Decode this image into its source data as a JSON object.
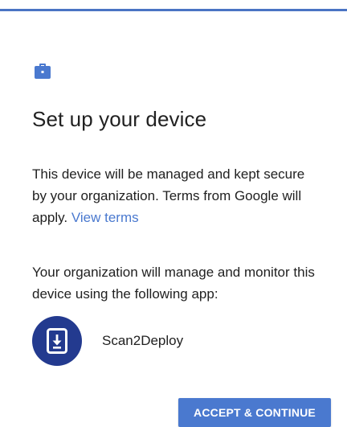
{
  "dialog": {
    "title": "Set up your device",
    "description": "This device will be managed and kept secure by your organization. Terms from Google will apply.",
    "terms_link": "View terms",
    "manage_text": "Your organization will manage and monitor this device using the following app:"
  },
  "app": {
    "name": "Scan2Deploy",
    "icon": "download-phone-icon"
  },
  "actions": {
    "accept_label": "ACCEPT & CONTINUE"
  },
  "colors": {
    "accent": "#4a79cf",
    "top_bar": "#4a74c4",
    "app_avatar": "#233a8f",
    "text": "#212121"
  },
  "icons": {
    "header": "briefcase-icon"
  }
}
